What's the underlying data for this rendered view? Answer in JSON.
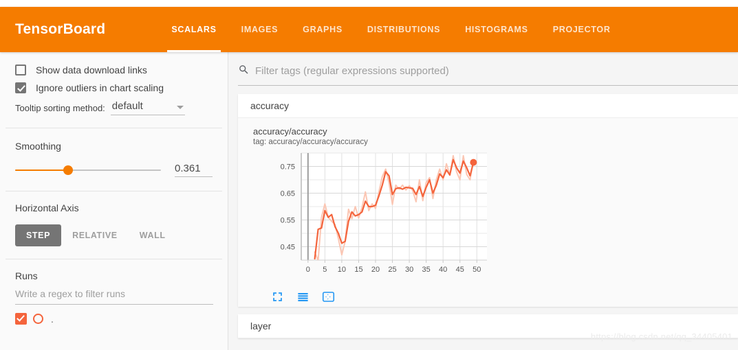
{
  "header": {
    "brand": "TensorBoard",
    "tabs": [
      {
        "label": "SCALARS",
        "active": true
      },
      {
        "label": "IMAGES",
        "active": false
      },
      {
        "label": "GRAPHS",
        "active": false
      },
      {
        "label": "DISTRIBUTIONS",
        "active": false
      },
      {
        "label": "HISTOGRAMS",
        "active": false
      },
      {
        "label": "PROJECTOR",
        "active": false
      }
    ],
    "accent_color": "#f57c00"
  },
  "sidebar": {
    "show_download_links": {
      "label": "Show data download links",
      "checked": false
    },
    "ignore_outliers": {
      "label": "Ignore outliers in chart scaling",
      "checked": true
    },
    "tooltip_sorting": {
      "label": "Tooltip sorting method:",
      "value": "default"
    },
    "smoothing": {
      "title": "Smoothing",
      "value": "0.361",
      "fraction": 0.361
    },
    "horizontal_axis": {
      "title": "Horizontal Axis",
      "options": [
        {
          "label": "STEP",
          "active": true
        },
        {
          "label": "RELATIVE",
          "active": false
        },
        {
          "label": "WALL",
          "active": false
        }
      ]
    },
    "runs": {
      "title": "Runs",
      "filter_placeholder": "Write a regex to filter runs",
      "items": [
        {
          "name": ".",
          "checked": true,
          "color": "#f4643c"
        }
      ]
    }
  },
  "main": {
    "search": {
      "placeholder": "Filter tags (regular expressions supported)",
      "value": "",
      "icon": "search-icon"
    },
    "cards": [
      {
        "title": "accuracy"
      },
      {
        "title": "layer"
      }
    ],
    "chart_card": {
      "chart_title": "accuracy/accuracy",
      "chart_tag": "tag: accuracy/accuracy/accuracy",
      "tools": [
        {
          "name": "expand-chart-icon"
        },
        {
          "name": "data-table-icon"
        },
        {
          "name": "fit-domain-icon"
        }
      ],
      "tool_color": "#2196f3"
    }
  },
  "watermark": "https://blog.csdn.net/qq_34405401",
  "chart_data": {
    "type": "line",
    "title": "accuracy/accuracy",
    "subtitle": "tag: accuracy/accuracy/accuracy",
    "xlabel": "",
    "ylabel": "",
    "xlim": [
      -2,
      53
    ],
    "ylim": [
      0.4,
      0.8
    ],
    "xticks": [
      0,
      5,
      10,
      15,
      20,
      25,
      30,
      35,
      40,
      45,
      50
    ],
    "yticks": [
      0.45,
      0.55,
      0.65,
      0.75
    ],
    "grid": true,
    "legend": "none",
    "line_color": "#f4643c",
    "raw_color": "#fbc6b3",
    "smoothing": 0.361,
    "last_point": {
      "x": 49,
      "y": 0.765
    },
    "series": [
      {
        "name": "accuracy (smoothed)",
        "x": [
          2,
          3,
          4,
          5,
          6,
          7,
          8,
          9,
          10,
          11,
          12,
          13,
          14,
          15,
          16,
          17,
          18,
          19,
          20,
          21,
          22,
          23,
          24,
          25,
          26,
          27,
          28,
          29,
          30,
          31,
          32,
          33,
          34,
          35,
          36,
          37,
          38,
          39,
          40,
          41,
          42,
          43,
          44,
          45,
          46,
          47,
          48,
          49
        ],
        "values": [
          0.405,
          0.515,
          0.52,
          0.585,
          0.56,
          0.57,
          0.525,
          0.5,
          0.463,
          0.47,
          0.545,
          0.58,
          0.565,
          0.57,
          0.58,
          0.62,
          0.6,
          0.6,
          0.605,
          0.64,
          0.68,
          0.73,
          0.715,
          0.645,
          0.667,
          0.67,
          0.665,
          0.672,
          0.67,
          0.668,
          0.645,
          0.675,
          0.638,
          0.672,
          0.7,
          0.65,
          0.68,
          0.722,
          0.708,
          0.737,
          0.718,
          0.775,
          0.745,
          0.725,
          0.77,
          0.745,
          0.715,
          0.765
        ]
      },
      {
        "name": "accuracy (raw)",
        "x": [
          2,
          3,
          4,
          5,
          6,
          7,
          8,
          9,
          10,
          11,
          12,
          13,
          14,
          15,
          16,
          17,
          18,
          19,
          20,
          21,
          22,
          23,
          24,
          25,
          26,
          27,
          28,
          29,
          30,
          31,
          32,
          33,
          34,
          35,
          36,
          37,
          38,
          39,
          40,
          41,
          42,
          43,
          44,
          45,
          46,
          47,
          48,
          49
        ],
        "values": [
          0.43,
          0.398,
          0.56,
          0.61,
          0.56,
          0.545,
          0.533,
          0.48,
          0.42,
          0.47,
          0.59,
          0.555,
          0.6,
          0.557,
          0.597,
          0.655,
          0.585,
          0.61,
          0.593,
          0.655,
          0.712,
          0.74,
          0.688,
          0.608,
          0.68,
          0.665,
          0.68,
          0.662,
          0.678,
          0.66,
          0.618,
          0.7,
          0.622,
          0.69,
          0.708,
          0.63,
          0.7,
          0.74,
          0.7,
          0.76,
          0.718,
          0.79,
          0.73,
          0.7,
          0.79,
          0.72,
          0.7,
          0.775
        ]
      }
    ]
  }
}
